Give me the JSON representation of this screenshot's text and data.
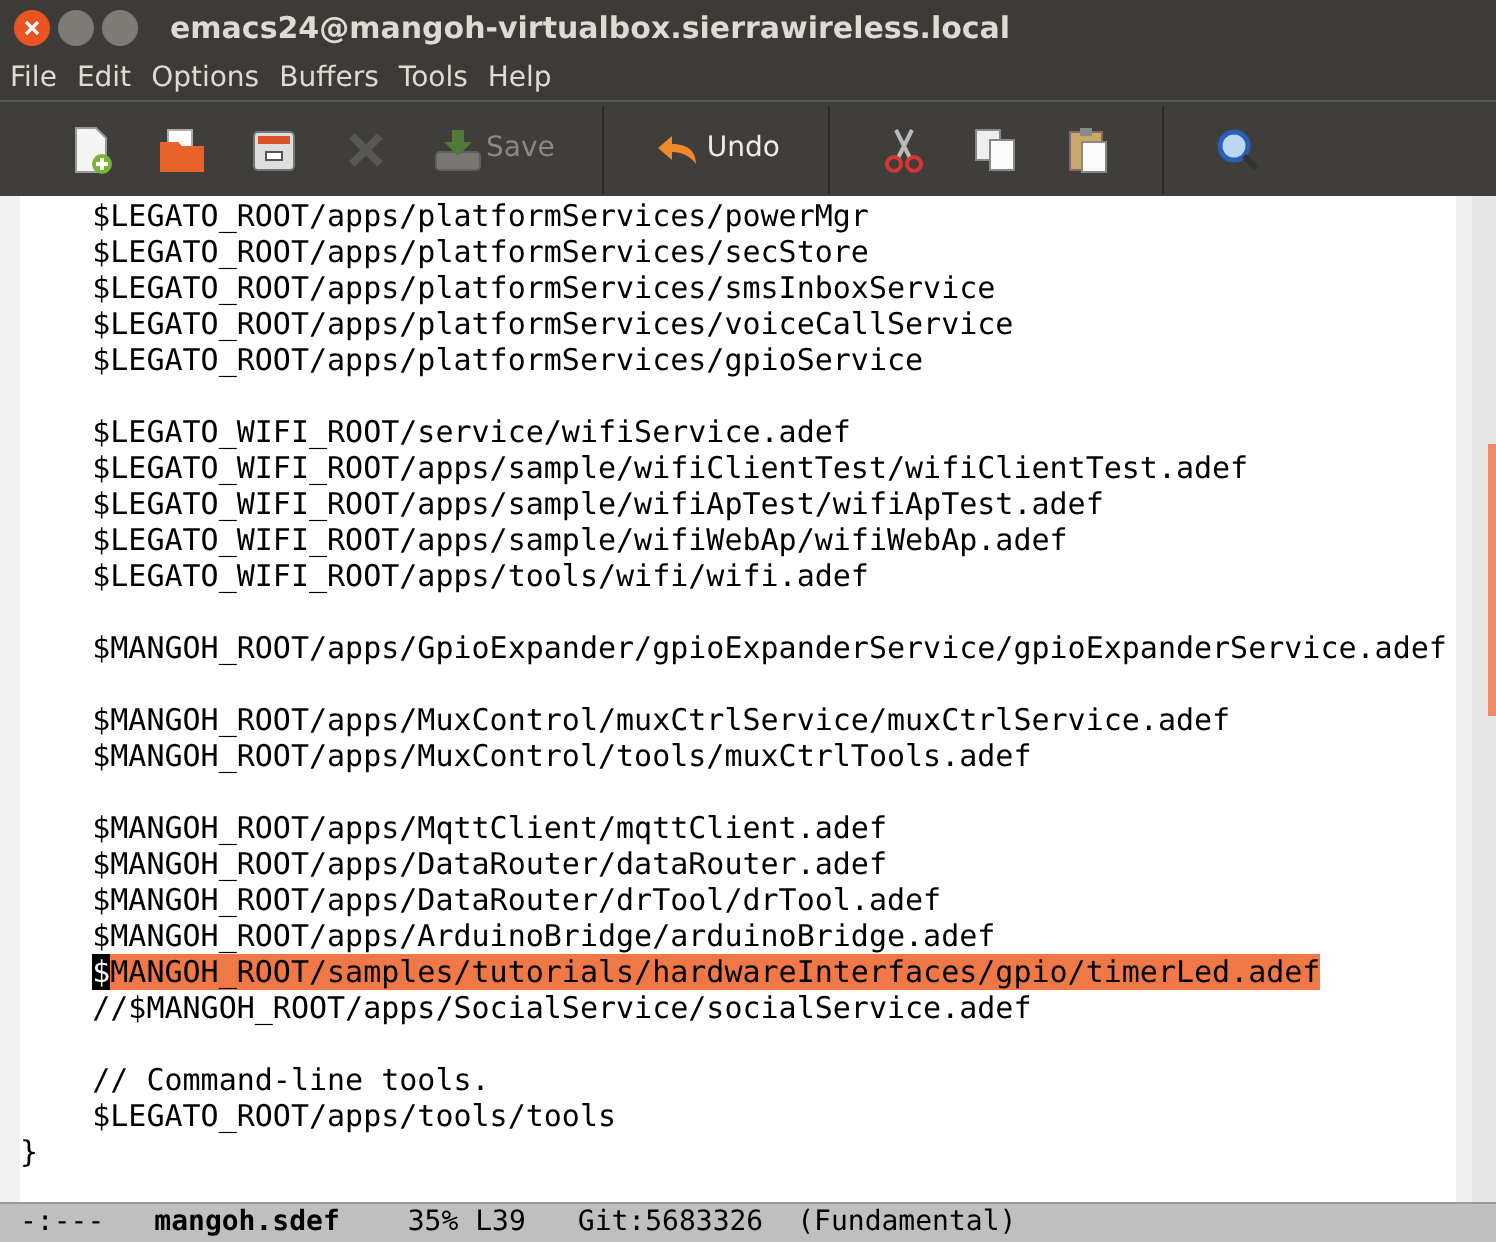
{
  "window": {
    "title": "emacs24@mangoh-virtualbox.sierrawireless.local"
  },
  "menu": [
    "File",
    "Edit",
    "Options",
    "Buffers",
    "Tools",
    "Help"
  ],
  "toolbar": [
    {
      "kind": "new-file",
      "disabled": false
    },
    {
      "kind": "open-folder",
      "disabled": false
    },
    {
      "kind": "cabinet",
      "disabled": false
    },
    {
      "kind": "close",
      "disabled": true
    },
    {
      "kind": "save",
      "label": "Save",
      "disabled": true
    },
    {
      "kind": "separator"
    },
    {
      "kind": "undo",
      "label": "Undo",
      "disabled": false
    },
    {
      "kind": "separator"
    },
    {
      "kind": "cut",
      "disabled": false
    },
    {
      "kind": "copy",
      "disabled": false
    },
    {
      "kind": "paste",
      "disabled": false
    },
    {
      "kind": "separator"
    },
    {
      "kind": "search",
      "disabled": false
    }
  ],
  "blocks": [
    {
      "lines": [
        {
          "text": "    $LEGATO_ROOT/apps/platformServices/powerMgr",
          "highlighted": false
        },
        {
          "text": "    $LEGATO_ROOT/apps/platformServices/secStore",
          "highlighted": false
        },
        {
          "text": "    $LEGATO_ROOT/apps/platformServices/smsInboxService",
          "highlighted": false
        },
        {
          "text": "    $LEGATO_ROOT/apps/platformServices/voiceCallService",
          "highlighted": false
        },
        {
          "text": "    $LEGATO_ROOT/apps/platformServices/gpioService",
          "highlighted": false
        }
      ]
    },
    {
      "lines": [
        {
          "text": "    $LEGATO_WIFI_ROOT/service/wifiService.adef",
          "highlighted": false
        },
        {
          "text": "    $LEGATO_WIFI_ROOT/apps/sample/wifiClientTest/wifiClientTest.adef",
          "highlighted": false
        },
        {
          "text": "    $LEGATO_WIFI_ROOT/apps/sample/wifiApTest/wifiApTest.adef",
          "highlighted": false
        },
        {
          "text": "    $LEGATO_WIFI_ROOT/apps/sample/wifiWebAp/wifiWebAp.adef",
          "highlighted": false
        },
        {
          "text": "    $LEGATO_WIFI_ROOT/apps/tools/wifi/wifi.adef",
          "highlighted": false
        }
      ]
    },
    {
      "lines": [
        {
          "text": "    $MANGOH_ROOT/apps/GpioExpander/gpioExpanderService/gpioExpanderService.adef",
          "highlighted": false
        }
      ]
    },
    {
      "lines": [
        {
          "text": "    $MANGOH_ROOT/apps/MuxControl/muxCtrlService/muxCtrlService.adef",
          "highlighted": false
        },
        {
          "text": "    $MANGOH_ROOT/apps/MuxControl/tools/muxCtrlTools.adef",
          "highlighted": false
        }
      ]
    },
    {
      "lines": [
        {
          "text": "    $MANGOH_ROOT/apps/MqttClient/mqttClient.adef",
          "highlighted": false
        },
        {
          "text": "    $MANGOH_ROOT/apps/DataRouter/dataRouter.adef",
          "highlighted": false
        },
        {
          "text": "    $MANGOH_ROOT/apps/DataRouter/drTool/drTool.adef",
          "highlighted": false
        },
        {
          "text": "    $MANGOH_ROOT/apps/ArduinoBridge/arduinoBridge.adef",
          "highlighted": false
        },
        {
          "text": "    $MANGOH_ROOT/samples/tutorials/hardwareInterfaces/gpio/timerLed.adef",
          "highlighted": true
        },
        {
          "text": "    //$MANGOH_ROOT/apps/SocialService/socialService.adef",
          "highlighted": false
        }
      ]
    },
    {
      "lines": [
        {
          "text": "    // Command-line tools.",
          "highlighted": false
        },
        {
          "text": "    $LEGATO_ROOT/apps/tools/tools",
          "highlighted": false
        },
        {
          "text": "}",
          "highlighted": false
        }
      ]
    }
  ],
  "mode_line": {
    "status": "-:---",
    "buffer": "mangoh.sdef",
    "position": "35% L39",
    "vc": "Git:5683326",
    "mode": "(Fundamental)"
  }
}
